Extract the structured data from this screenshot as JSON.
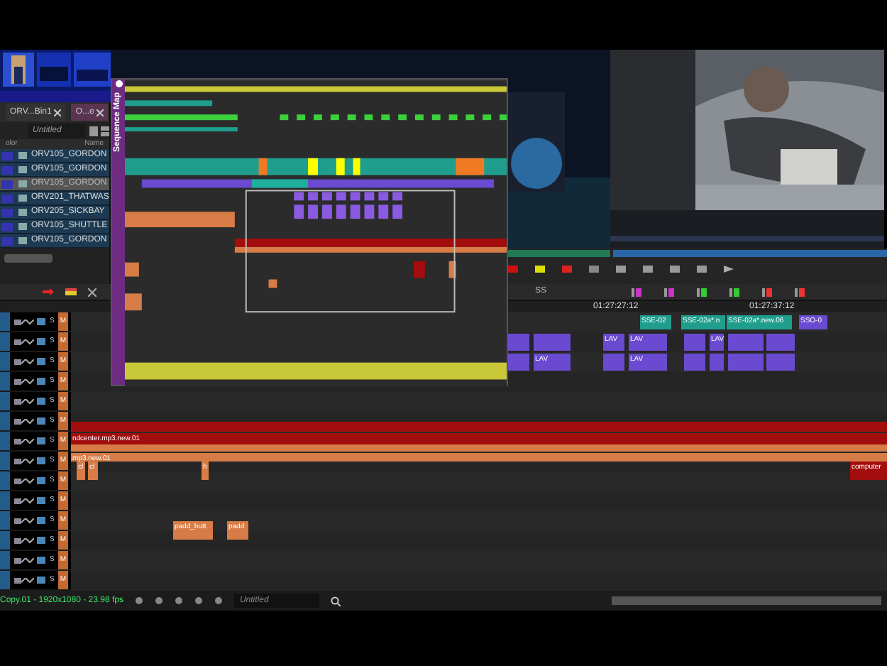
{
  "bin": {
    "tabs": [
      {
        "label": "ORV...Bin1",
        "selected": false
      },
      {
        "label": "O...e",
        "selected": true
      }
    ],
    "view": "Untitled",
    "columns": [
      "olor",
      "Name"
    ],
    "rows": [
      {
        "name": "ORV105_GORDON",
        "selected": false
      },
      {
        "name": "ORV105_GORDON",
        "selected": false
      },
      {
        "name": "ORV105_GORDON",
        "selected": true
      },
      {
        "name": "ORV201_THATWAS",
        "selected": false
      },
      {
        "name": "ORV205_SICKBAY",
        "selected": false
      },
      {
        "name": "ORV105_SHUTTLE",
        "selected": false
      },
      {
        "name": "ORV105_GORDON",
        "selected": false
      }
    ]
  },
  "sequence_map": {
    "title": "Sequence Map"
  },
  "toolbar": {
    "label": "SS"
  },
  "ruler": [
    "01:27:27:12",
    "01:27:37:12"
  ],
  "tracks": [
    {
      "solo": "S",
      "mute": "M",
      "clips": [
        {
          "label": "SSE-02",
          "kind": "teal"
        },
        {
          "label": "SSE-02a*.n",
          "kind": "teal"
        },
        {
          "label": "SSE-02a*.new.06",
          "kind": "teal"
        },
        {
          "label": "SSO-0",
          "kind": "video"
        }
      ]
    },
    {
      "solo": "S",
      "mute": "M",
      "clips": [
        {
          "kind": "video"
        },
        {
          "kind": "video"
        },
        {
          "label": "LAV",
          "kind": "video"
        },
        {
          "label": "LAV",
          "kind": "video"
        },
        {
          "kind": "video"
        },
        {
          "label": "LAV",
          "kind": "video"
        },
        {
          "kind": "video"
        },
        {
          "kind": "video"
        }
      ]
    },
    {
      "solo": "S",
      "mute": "M",
      "clips": [
        {
          "kind": "video"
        },
        {
          "label": "LAV",
          "kind": "video"
        },
        {
          "kind": "video"
        },
        {
          "label": "LAV",
          "kind": "video"
        },
        {
          "kind": "video"
        },
        {
          "kind": "video"
        },
        {
          "kind": "video"
        },
        {
          "kind": "video"
        }
      ]
    },
    {
      "solo": "S",
      "mute": "M"
    },
    {
      "solo": "S",
      "mute": "M"
    },
    {
      "solo": "S",
      "mute": "M",
      "clips": [
        {
          "kind": "red"
        }
      ]
    },
    {
      "solo": "S",
      "mute": "M",
      "clips": [
        {
          "label": "ndcenter.mp3.new.01",
          "kind": "red"
        },
        {
          "kind": "audio"
        }
      ]
    },
    {
      "solo": "S",
      "mute": "M",
      "clips": [
        {
          "label": "mp3.new.01",
          "kind": "audio"
        },
        {
          "label": "cl",
          "kind": "audio"
        },
        {
          "label": "cl",
          "kind": "audio"
        },
        {
          "label": "h",
          "kind": "audio"
        },
        {
          "label": "computer",
          "kind": "red"
        }
      ]
    },
    {
      "solo": "S",
      "mute": "M"
    },
    {
      "solo": "S",
      "mute": "M"
    },
    {
      "solo": "S",
      "mute": "M",
      "clips": [
        {
          "label": "padd_butt",
          "kind": "audio"
        },
        {
          "label": "padd",
          "kind": "audio"
        }
      ]
    },
    {
      "solo": "S",
      "mute": "M"
    },
    {
      "solo": "S",
      "mute": "M"
    },
    {
      "solo": "S",
      "mute": "M"
    }
  ],
  "status_bar": {
    "sequence": "Copy.01 - 1920x1080 - 23.98 fps",
    "view": "Untitled"
  }
}
